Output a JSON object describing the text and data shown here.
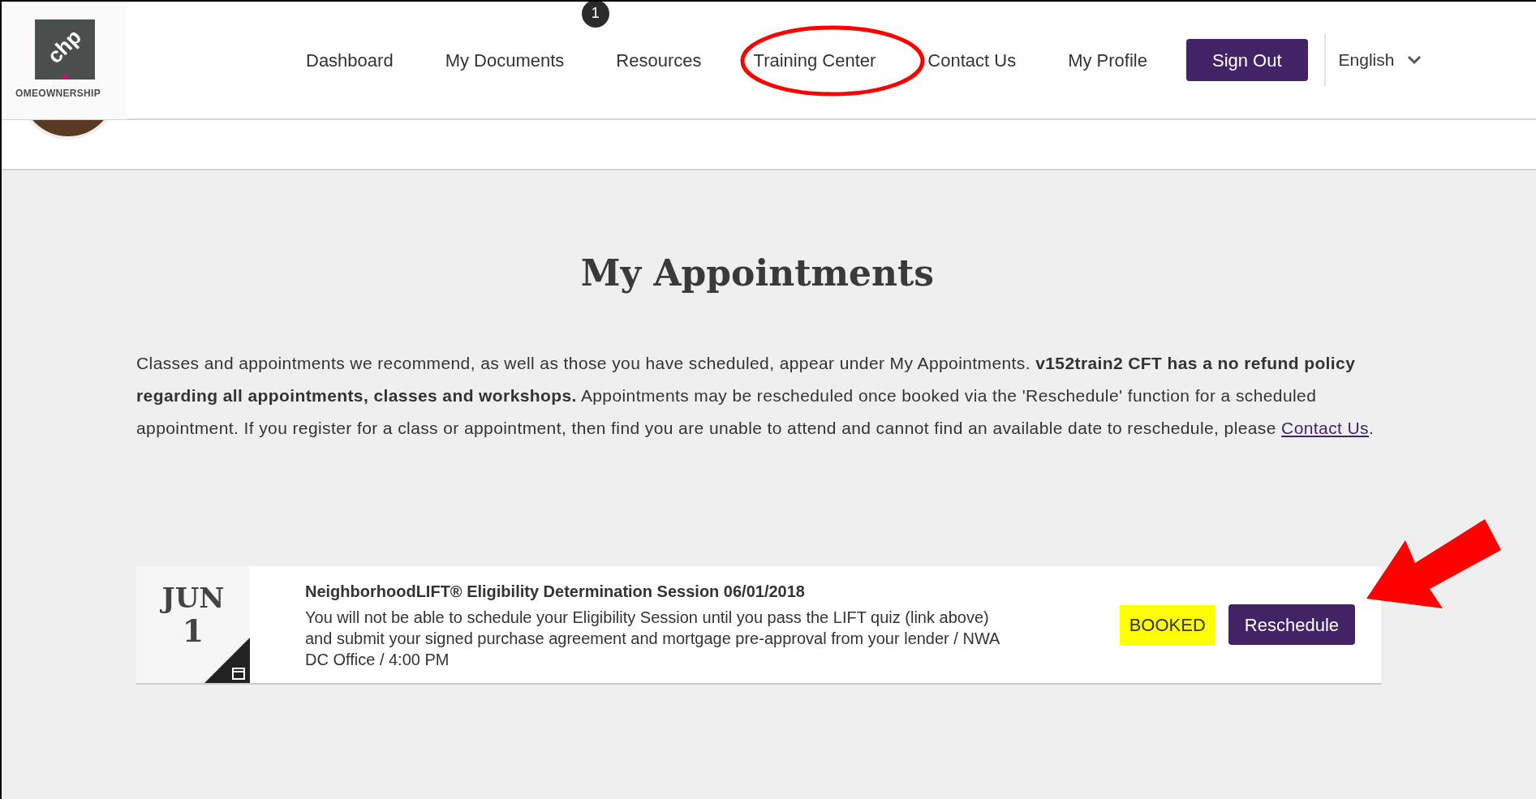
{
  "header": {
    "logo_mark": "chp",
    "logo_text": "OMEOWNERSHIP",
    "nav": [
      {
        "label": "Dashboard"
      },
      {
        "label": "My Documents",
        "badge": "1"
      },
      {
        "label": "Resources"
      },
      {
        "label": "Training Center",
        "circled": true
      },
      {
        "label": "Contact Us"
      },
      {
        "label": "My Profile"
      }
    ],
    "sign_out": "Sign Out",
    "language": "English"
  },
  "page_title": "My Appointments",
  "intro": {
    "text": "Classes and appointments we recommend, as well as those you have scheduled, appear under My Appointments. **v152train2 CFT has a no refund policy regarding all appointments, classes and workshops.** Appointments may be rescheduled once booked via the 'Reschedule' function for a scheduled appointment. If you register for a class or appointment, then find you are unable to attend and cannot find an available date to reschedule, please ",
    "link": "Contact Us",
    "text_after": "."
  },
  "appointments": [
    {
      "month": "JUN",
      "day": "1",
      "title": "NeighborhoodLIFT® Eligibility Determination Session  06/01/2018",
      "description": "You will not be able to schedule your Eligibility Session until you pass the LIFT quiz (link above) and submit your signed purchase agreement and mortgage pre-approval from your lender  / NWA DC Office  / 4:00 PM",
      "status": "BOOKED",
      "status_highlighted": true,
      "action": "Reschedule",
      "arrow_pointer": true
    }
  ]
}
